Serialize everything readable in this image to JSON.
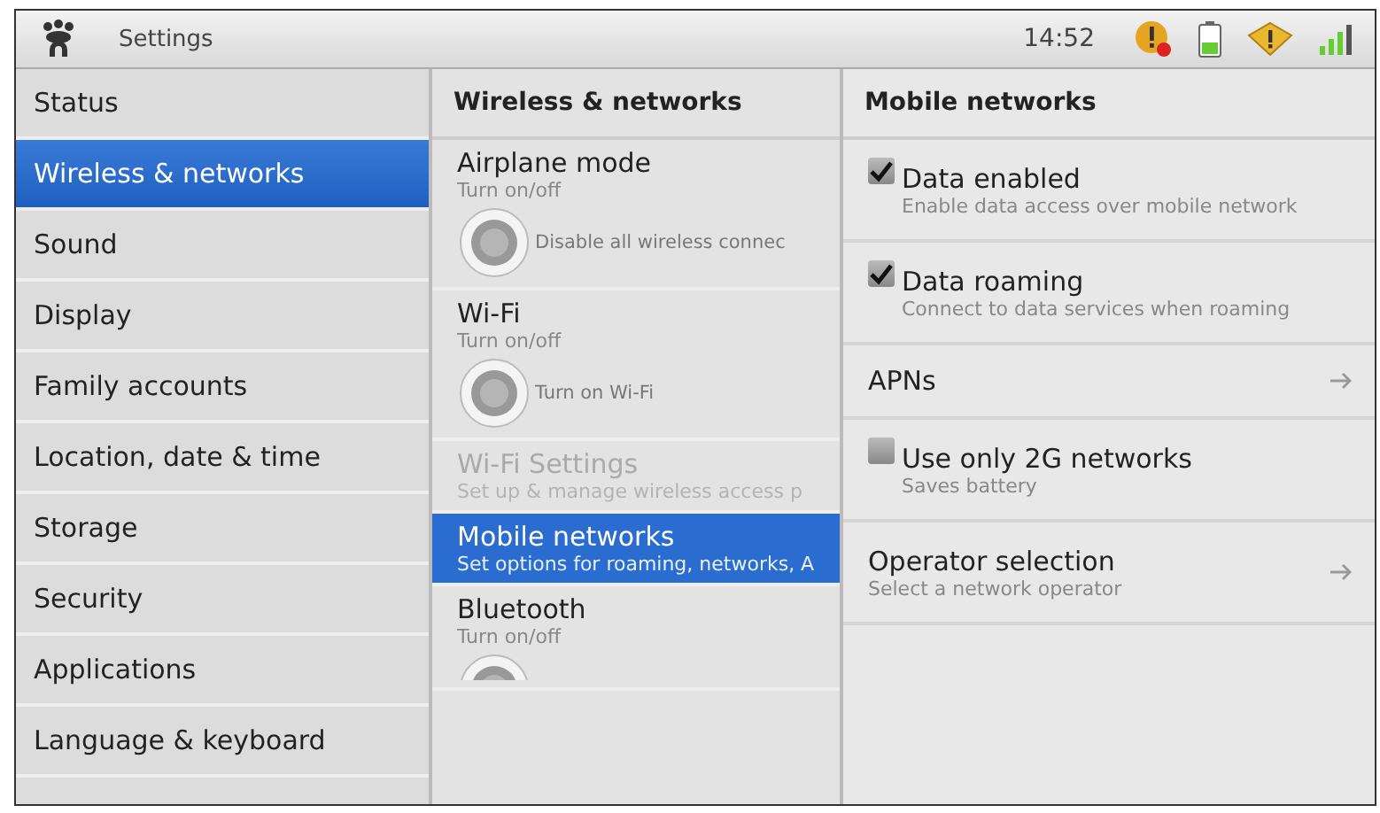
{
  "status_bar": {
    "title": "Settings",
    "time": "14:52"
  },
  "categories": [
    {
      "label": "Status",
      "selected": false
    },
    {
      "label": "Wireless & networks",
      "selected": true
    },
    {
      "label": "Sound",
      "selected": false
    },
    {
      "label": "Display",
      "selected": false
    },
    {
      "label": "Family accounts",
      "selected": false
    },
    {
      "label": "Location, date & time",
      "selected": false
    },
    {
      "label": "Storage",
      "selected": false
    },
    {
      "label": "Security",
      "selected": false
    },
    {
      "label": "Applications",
      "selected": false
    },
    {
      "label": "Language & keyboard",
      "selected": false
    }
  ],
  "wireless": {
    "header": "Wireless & networks",
    "items": [
      {
        "kind": "toggle",
        "title": "Airplane mode",
        "summary": "Turn on/off",
        "toggle_label": "Disable all wireless connec",
        "selected": false,
        "disabled": false
      },
      {
        "kind": "toggle",
        "title": "Wi-Fi",
        "summary": "Turn on/off",
        "toggle_label": "Turn on Wi-Fi",
        "selected": false,
        "disabled": false
      },
      {
        "kind": "link",
        "title": "Wi-Fi Settings",
        "summary": "Set up & manage wireless access p",
        "selected": false,
        "disabled": true
      },
      {
        "kind": "link",
        "title": "Mobile networks",
        "summary": "Set options for roaming, networks, A",
        "selected": true,
        "disabled": false
      },
      {
        "kind": "toggle_cut",
        "title": "Bluetooth",
        "summary": "Turn on/off",
        "selected": false,
        "disabled": false
      }
    ]
  },
  "mobile": {
    "header": "Mobile networks",
    "items": [
      {
        "kind": "checkbox",
        "title": "Data enabled",
        "summary": "Enable data access over mobile network",
        "checked": true
      },
      {
        "kind": "checkbox",
        "title": "Data roaming",
        "summary": "Connect to data services when roaming",
        "checked": true
      },
      {
        "kind": "link",
        "title": "APNs"
      },
      {
        "kind": "checkbox",
        "title": "Use only 2G networks",
        "summary": "Saves battery",
        "checked": false
      },
      {
        "kind": "link",
        "title": "Operator selection",
        "summary": "Select a network operator"
      }
    ]
  }
}
